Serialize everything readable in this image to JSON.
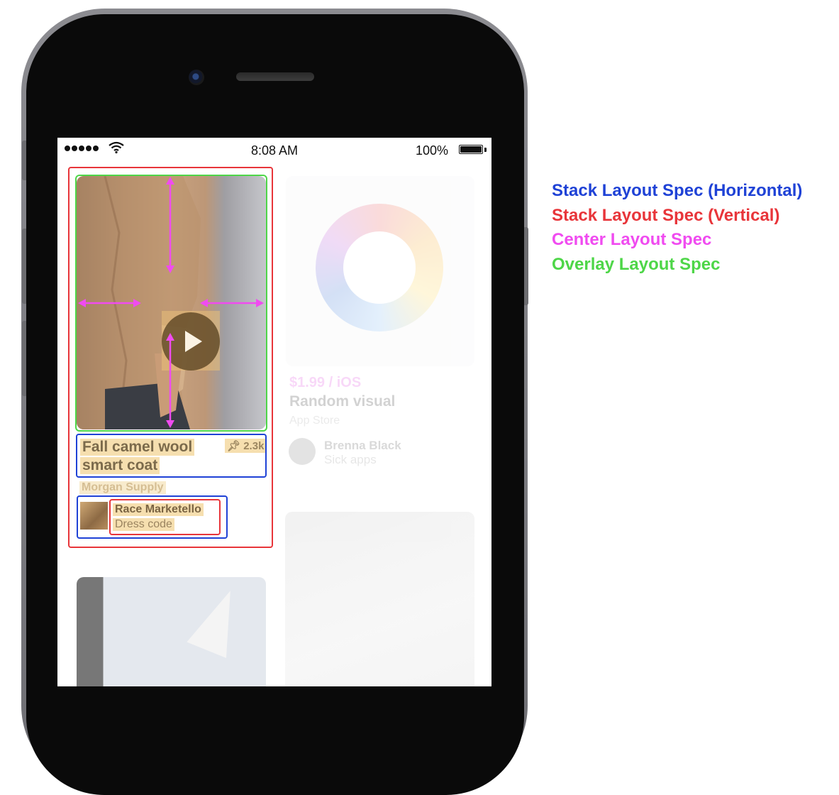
{
  "statusbar": {
    "time": "8:08 AM",
    "battery": "100%"
  },
  "feed": {
    "pin": {
      "title_line1": "Fall camel wool",
      "title_line2": "smart coat",
      "pin_count": "2.3k",
      "brand": "Morgan Supply",
      "author_name": "Race Marketello",
      "author_board": "Dress code"
    },
    "app_pin": {
      "price": "$1.99 / iOS",
      "title": "Random visual",
      "source": "App Store",
      "author_name": "Brenna Black",
      "author_board": "Sick apps"
    }
  },
  "legend": {
    "items": [
      {
        "label": "Stack Layout Spec (Horizontal)",
        "color": "#1f42d6"
      },
      {
        "label": "Stack Layout Spec (Vertical)",
        "color": "#e8353a"
      },
      {
        "label": "Center Layout Spec",
        "color": "#f04bf0"
      },
      {
        "label": "Overlay Layout Spec",
        "color": "#4ed648"
      }
    ]
  },
  "icons": {
    "play": "play-icon",
    "pin": "pin-icon",
    "wifi": "wifi-icon",
    "signal": "signal-icon",
    "battery": "battery-icon"
  }
}
